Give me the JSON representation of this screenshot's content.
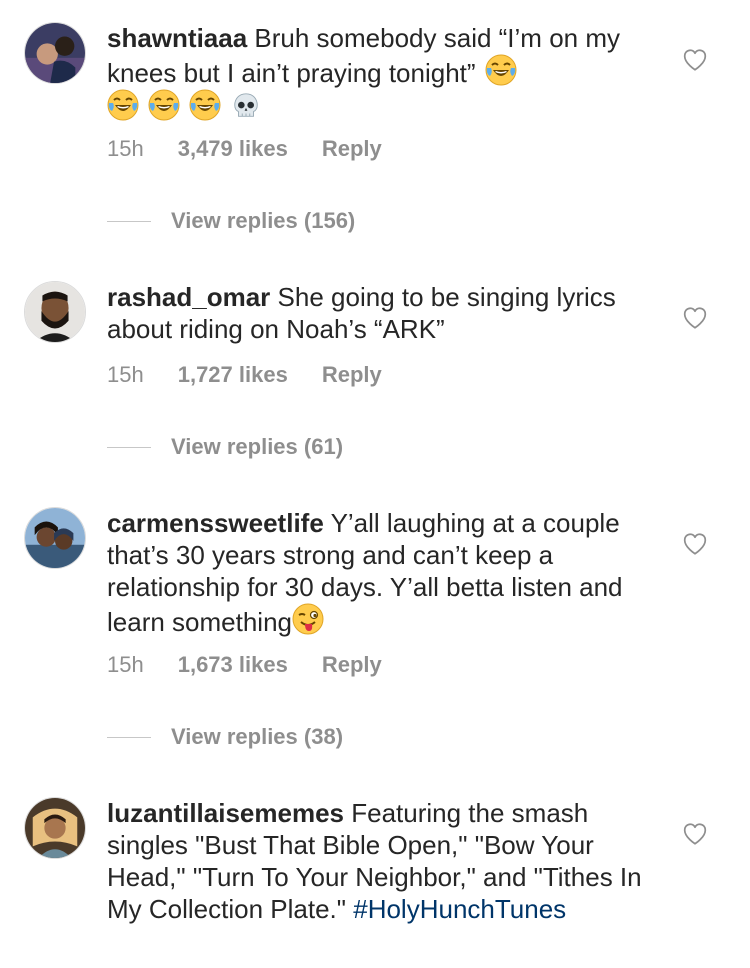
{
  "comments": [
    {
      "username": "shawntiaaa",
      "text": "Bruh somebody said “I’m on my knees but I ain’t praying tonight”",
      "time": "15h",
      "likes": "3,479 likes",
      "reply_label": "Reply",
      "view_replies": "View replies (156)"
    },
    {
      "username": "rashad_omar",
      "text": "She going to be singing lyrics about riding on Noah’s “ARK”",
      "time": "15h",
      "likes": "1,727 likes",
      "reply_label": "Reply",
      "view_replies": "View replies (61)"
    },
    {
      "username": "carmenssweetlife",
      "text": "Y’all laughing at a couple that’s 30 years strong and can’t keep a relationship for 30 days. Y’all betta listen and learn something",
      "time": "15h",
      "likes": "1,673 likes",
      "reply_label": "Reply",
      "view_replies": "View replies (38)"
    },
    {
      "username": "luzantillaisememes",
      "text": "Featuring the smash singles \"Bust That Bible Open,\" \"Bow Your Head,\" \"Turn To Your Neighbor,\" and \"Tithes In My Collection Plate.\"",
      "hashtag": "#HolyHunchTunes"
    }
  ],
  "icons": {
    "like": "heart-outline-icon",
    "laughing": "face-with-tears-of-joy-icon",
    "skull": "skull-icon",
    "winking": "winking-face-with-tongue-icon"
  },
  "colors": {
    "text": "#262626",
    "secondary": "#8e8e8e",
    "hashtag": "#003569"
  }
}
